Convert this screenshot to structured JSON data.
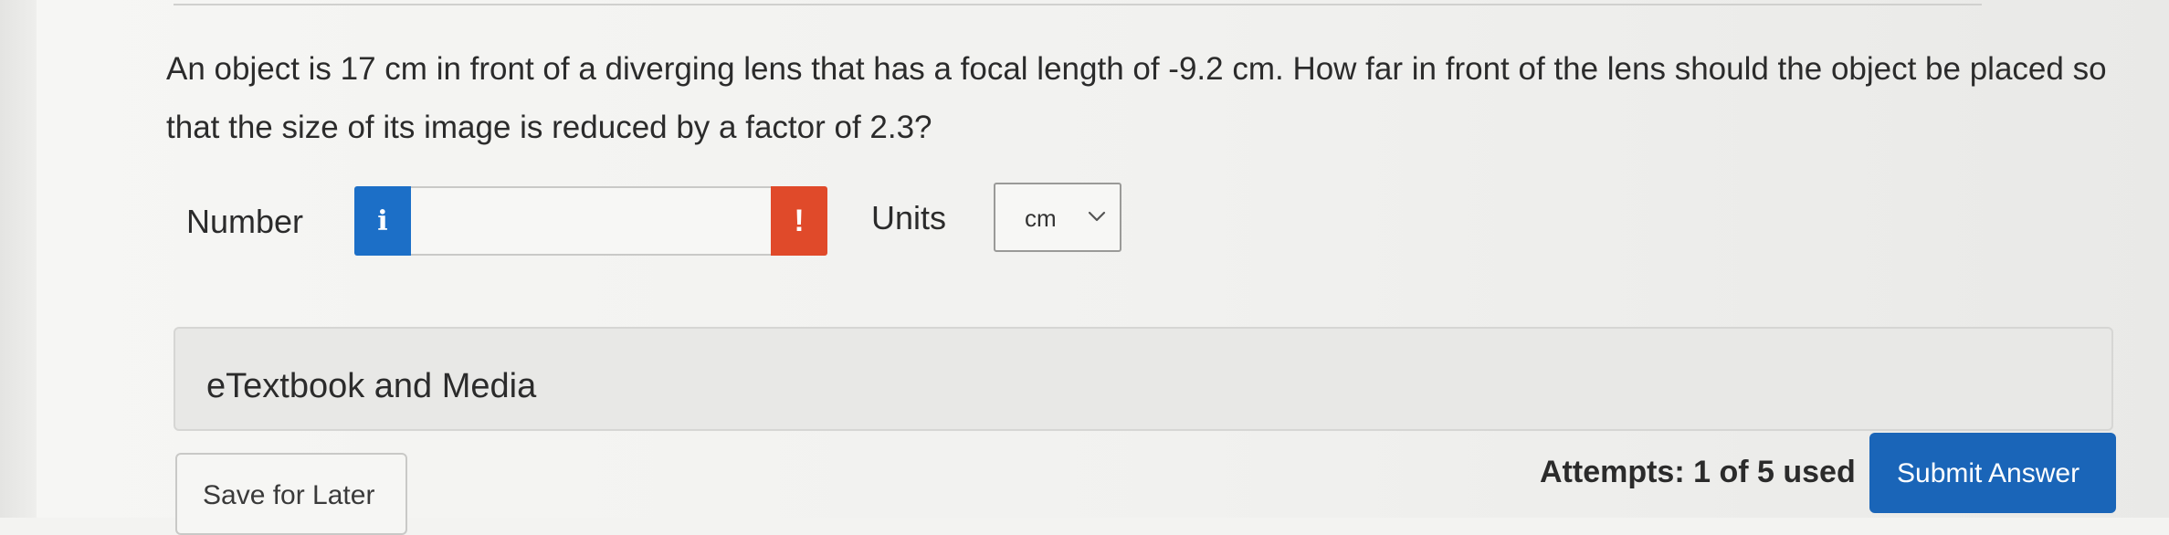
{
  "question": {
    "text": "An object is 17 cm in front of a diverging lens that has a focal length of -9.2 cm. How far in front of the lens should the object be placed so that the size of its image is reduced by a factor of 2.3?"
  },
  "answer": {
    "number_label": "Number",
    "info_icon_glyph": "i",
    "number_value": "",
    "error_icon_glyph": "!",
    "units_label": "Units",
    "units_selected": "cm"
  },
  "etextbook": {
    "label": "eTextbook and Media"
  },
  "footer": {
    "save_label": "Save for Later",
    "attempts_text": "Attempts: 1 of 5 used",
    "submit_label": "Submit Answer"
  },
  "colors": {
    "info_blue": "#1c6fc7",
    "error_red": "#e04a2a",
    "submit_blue": "#1a65b8"
  },
  "icons": {
    "info": "info-icon",
    "error": "exclamation-icon",
    "chevron": "chevron-down-icon"
  }
}
